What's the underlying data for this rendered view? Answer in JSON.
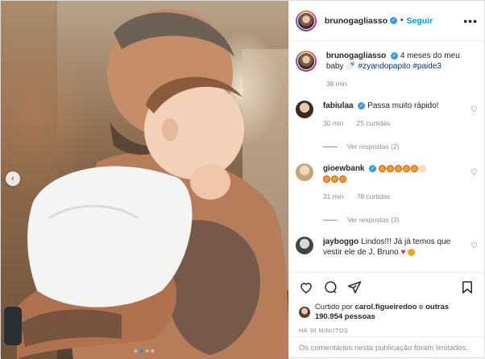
{
  "post": {
    "username": "brunogagliasso",
    "separator": "•",
    "follow_label": "Seguir",
    "more_label": "•••",
    "caption_text": "4 meses do meu baby",
    "caption_tags": "#zyandopapito #paide3",
    "caption_time": "38 min",
    "carousel_prev": "‹"
  },
  "comments": [
    {
      "username": "fabiulaa",
      "text": "Passa muito rápido!",
      "time": "30 min",
      "likes": "25 curtidas",
      "replies": "Ver respostas (2)"
    },
    {
      "username": "gioewbank",
      "text": "",
      "time": "31 min",
      "likes": "78 curtidas",
      "replies": "Ver respostas (3)"
    },
    {
      "username": "jayboggo",
      "text": "Lindos!!! Já já temos que vestir ele de J, Bruno"
    }
  ],
  "likes": {
    "prefix": "Curtido por",
    "user": "carol.figueiredoo",
    "connector": "e",
    "others": "outras 190.954 pessoas"
  },
  "date": "HÁ 38 MINUTOS",
  "footer": "Os comentários nesta publicação foram limitados.",
  "colors": {
    "accent": "#0095f6",
    "verified": "#3897f0",
    "muted": "#8e8e8e"
  }
}
